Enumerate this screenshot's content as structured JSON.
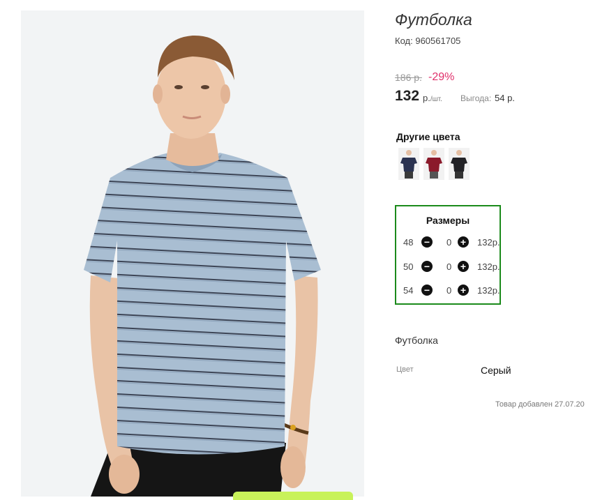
{
  "product": {
    "title": "Футболка",
    "code_label": "Код:",
    "code": "960561705",
    "old_price": "186 р.",
    "discount": "-29%",
    "price": "132",
    "currency": "р.",
    "unit_suffix": "/шт.",
    "benefit_label": "Выгода:",
    "benefit_value": "54 р.",
    "photo_icon": "model-tshirt-photo"
  },
  "colors": {
    "title": "Другие цвета",
    "swatches": [
      {
        "name": "navy",
        "shirt": "#2b3350"
      },
      {
        "name": "burgundy",
        "shirt": "#8b1a2b"
      },
      {
        "name": "black",
        "shirt": "#222226"
      }
    ]
  },
  "sizes": {
    "title": "Размеры",
    "rows": [
      {
        "size": "48",
        "qty": "0",
        "price": "132р."
      },
      {
        "size": "50",
        "qty": "0",
        "price": "132р."
      },
      {
        "size": "54",
        "qty": "0",
        "price": "132р."
      }
    ],
    "minus_icon": "minus-circle-icon",
    "plus_icon": "plus-circle-icon"
  },
  "details": {
    "description": "Футболка",
    "color_label": "Цвет",
    "color_value": "Серый",
    "added_text": "Товар добавлен 27.07.20"
  },
  "colors_style": {
    "sizes_border": "#1b8a1b",
    "discount": "#e0306b",
    "shirt": "#a9bed2"
  }
}
